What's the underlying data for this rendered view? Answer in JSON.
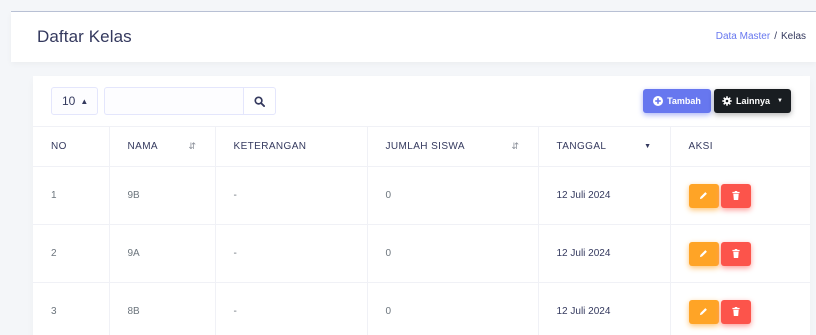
{
  "header": {
    "title": "Daftar Kelas",
    "breadcrumb": [
      "Data Master",
      "Kelas"
    ],
    "breadcrumb_separator": "/"
  },
  "toolbar": {
    "per_page": "10",
    "search_value": "",
    "search_placeholder": "",
    "add_label": "Tambah",
    "more_label": "Lainnya"
  },
  "table": {
    "columns": [
      "NO",
      "NAMA",
      "KETERANGAN",
      "JUMLAH SISWA",
      "TANGGAL",
      "AKSI"
    ],
    "rows": [
      {
        "no": "1",
        "nama": "9B",
        "keterangan": "-",
        "jumlah": "0",
        "tanggal": "12 Juli 2024"
      },
      {
        "no": "2",
        "nama": "9A",
        "keterangan": "-",
        "jumlah": "0",
        "tanggal": "12 Juli 2024"
      },
      {
        "no": "3",
        "nama": "8B",
        "keterangan": "-",
        "jumlah": "0",
        "tanggal": "12 Juli 2024"
      }
    ]
  },
  "icons": {
    "search": "search-icon",
    "add": "plus-circle-icon",
    "more": "gear-icon",
    "edit": "pencil-icon",
    "delete": "trash-icon"
  },
  "colors": {
    "primary": "#6777ef",
    "dark": "#191d21",
    "warning": "#ffa426",
    "danger": "#fc544b"
  }
}
